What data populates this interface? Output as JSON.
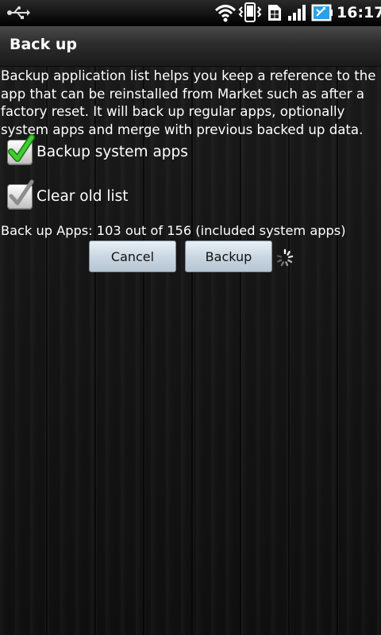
{
  "status_bar": {
    "time": "16:17",
    "icons": [
      "usb-icon",
      "wifi-icon",
      "vibrate-icon",
      "sim-card-icon",
      "signal-icon",
      "battery-icon"
    ]
  },
  "dialog": {
    "title": "Back up",
    "description": "Backup application list helps you keep a reference to the app that can be reinstalled from Market such as after a factory reset. It will back up regular apps, optionally system apps and merge with previous backed up data.",
    "options": [
      {
        "label": "Backup system apps",
        "checked": true
      },
      {
        "label": "Clear old list",
        "checked": false
      }
    ],
    "progress_text": "Back up Apps: 103 out of 156 (included system apps)",
    "buttons": {
      "cancel": "Cancel",
      "backup": "Backup"
    }
  },
  "colors": {
    "check_green": "#3fce2f",
    "button_face": "#cad7e2",
    "title_bar": "#2c2c2c"
  }
}
